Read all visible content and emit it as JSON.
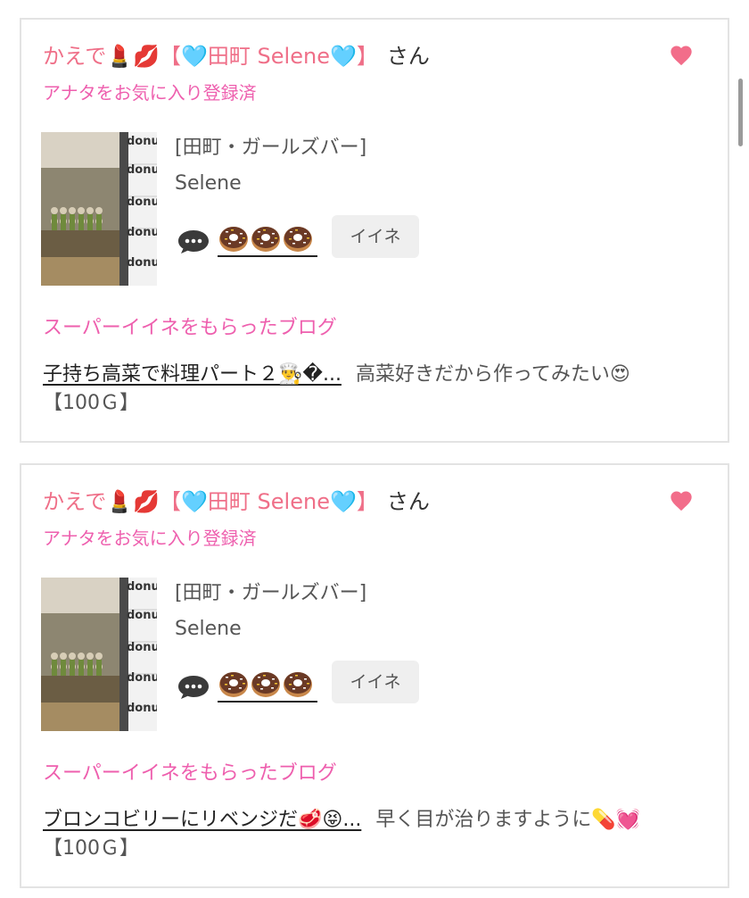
{
  "cards": [
    {
      "sender_name": "かえで💄💋【🩵田町 Selene🩵】",
      "honorific": "さん",
      "favorite_status": "アナタをお気に入り登録済",
      "shop": "[田町・ガールズバー]",
      "girl_name": "Selene",
      "iine_label": "イイネ",
      "blog_heading": "スーパーイイネをもらったブログ",
      "blog_title": "子持ち高菜で料理パート２👨‍🍳�...",
      "blog_comment": "高菜好きだから作ってみたい😍",
      "reward": "【100Ｇ】"
    },
    {
      "sender_name": "かえで💄💋【🩵田町 Selene🩵】",
      "honorific": "さん",
      "favorite_status": "アナタをお気に入り登録済",
      "shop": "[田町・ガールズバー]",
      "girl_name": "Selene",
      "iine_label": "イイネ",
      "blog_heading": "スーパーイイネをもらったブログ",
      "blog_title": "ブロンコビリーにリベンジだ🥩😝...",
      "blog_comment": "早く目が治りますように💊💓",
      "reward": "【100Ｇ】"
    }
  ],
  "thumbnail_sign_text": "donu",
  "colors": {
    "accent_pink": "#ef6f88",
    "heading_pink": "#ee5fae",
    "heart": "#f26d8a",
    "button_bg": "#efefef",
    "card_border": "#e3e3e3"
  },
  "icons": [
    "heart-icon",
    "comment-bubble-icon",
    "donut-icon"
  ]
}
